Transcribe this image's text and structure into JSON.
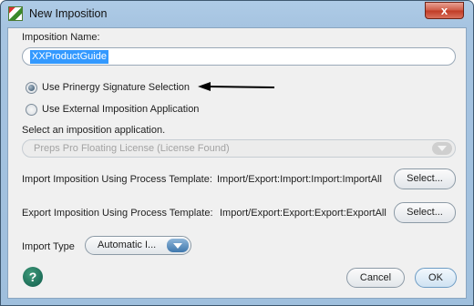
{
  "window": {
    "title": "New Imposition",
    "close_symbol": "x"
  },
  "form": {
    "name_label": "Imposition Name:",
    "name_value": "XXProductGuide",
    "radio_signature": "Use Prinergy Signature Selection",
    "radio_external": "Use External Imposition Application",
    "app_label": "Select an imposition application.",
    "app_value": "Preps Pro Floating License (License Found)",
    "import_template_label": "Import Imposition Using Process Template:",
    "import_template_path": "Import/Export:Import:Import:ImportAll",
    "export_template_label": "Export Imposition Using Process Template:",
    "export_template_path": "Import/Export:Export:Export:ExportAll",
    "select_label": "Select...",
    "import_type_label": "Import Type",
    "import_type_value": "Automatic I..."
  },
  "footer": {
    "help_symbol": "?",
    "cancel_label": "Cancel",
    "ok_label": "OK"
  },
  "colors": {
    "title_bar": "#a6c4e1",
    "selection": "#3399ff",
    "help_button": "#14624f",
    "close_button": "#c9482f",
    "arrow": "#000000"
  },
  "icons": [
    "app-icon",
    "close-icon",
    "dropdown-arrow-icon",
    "arrow-annotation",
    "help-icon"
  ]
}
